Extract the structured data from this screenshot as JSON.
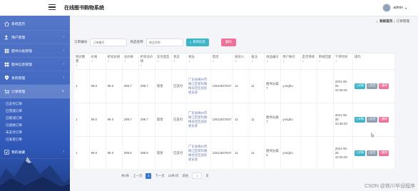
{
  "app": {
    "title": "在线图书购物系统",
    "user_name": "admin",
    "caret": "▾"
  },
  "sidebar": {
    "items": [
      {
        "label": "系统首页",
        "icon": "home-icon",
        "arrow": ""
      },
      {
        "label": "用户管理",
        "icon": "users-icon",
        "arrow": "‹"
      },
      {
        "label": "图书分类管理",
        "icon": "grid-icon",
        "arrow": "‹"
      },
      {
        "label": "图书信息管理",
        "icon": "grid-icon",
        "arrow": "‹"
      },
      {
        "label": "系统管理",
        "icon": "pin-icon",
        "arrow": "‹"
      },
      {
        "label": "订单管理",
        "icon": "cart-icon",
        "arrow": "∨"
      }
    ],
    "submenu": [
      "已支付订单",
      "已完成订单",
      "已取消订单",
      "已退款订单",
      "未支付订单",
      "已发货订单"
    ],
    "last_item": {
      "label": "我的收藏",
      "icon": "star-icon",
      "arrow": "‹"
    }
  },
  "breadcrumb": {
    "home": "系统首页",
    "separator": "/",
    "current": "订单管理"
  },
  "filter": {
    "order_no_label": "订单编号",
    "order_no_placeholder": "订单编号",
    "book_name_label": "商品名称",
    "book_name_placeholder": "商品名称",
    "search_label": "查询信息",
    "delete_label": "删除"
  },
  "table": {
    "columns": [
      {
        "label": "购买数量",
        "sort": "⇕"
      },
      {
        "label": "价格",
        "sort": "⇕"
      },
      {
        "label": "折扣价格",
        "sort": "⇕"
      },
      {
        "label": "总价格",
        "sort": "⇕"
      },
      {
        "label": "折扣总价格",
        "sort": "⇕"
      },
      {
        "label": "支付类型",
        "sort": "⇕"
      },
      {
        "label": "状态",
        "sort": "⇕"
      },
      {
        "label": "地址",
        "sort": "⇕"
      },
      {
        "label": "电话",
        "sort": "⇕"
      },
      {
        "label": "收货人",
        "sort": "⇕"
      },
      {
        "label": "备注",
        "sort": "⇕"
      },
      {
        "label": "商品编号",
        "sort": "⇕"
      },
      {
        "label": "用户账号",
        "sort": "⇕"
      },
      {
        "label": "是否审核",
        "sort": "⇕"
      },
      {
        "label": "审核回复",
        "sort": "⇕"
      },
      {
        "label": "下单时间",
        "sort": "⇕"
      },
      {
        "label": "操作",
        "sort": ""
      }
    ],
    "rows": [
      {
        "qty": "1",
        "price": "99.0",
        "discount_price": "99.0",
        "total": "299.7",
        "discount_total": "299.7",
        "pay": "现金",
        "status": "已支付",
        "address": "广东省梅州市梅江区新科路-梅龙社区居民委员会",
        "phone": "13612547847",
        "receiver": "11",
        "remark": "11",
        "product": "图书分类7",
        "user": "yonghu",
        "audited": "",
        "reply": "",
        "time": "2021-05-25 10:36:03"
      },
      {
        "qty": "1",
        "price": "99.0",
        "discount_price": "99.0",
        "total": "299.7",
        "discount_total": "299.7",
        "pay": "现金",
        "status": "已支付",
        "address": "广东省梅州市梅江区新科路-梅龙社区居民委员会",
        "phone": "13612547847",
        "receiver": "11",
        "remark": "11",
        "product": "图书分类7",
        "user": "yonghu",
        "audited": "",
        "reply": "",
        "time": "2021-05-25 10:36:03"
      },
      {
        "qty": "1",
        "price": "99.0",
        "discount_price": "99.0",
        "total": "299.6",
        "discount_total": "299.6",
        "pay": "现金",
        "status": "已支付",
        "address": "广东省梅州市梅江区新科路-梅龙社区居民委员会",
        "phone": "13612547847",
        "receiver": "11",
        "remark": "11",
        "product": "图书分类5",
        "user": "yonghu",
        "audited": "",
        "reply": "",
        "time": "2021-05-25 10:36:03"
      }
    ],
    "ops": {
      "detail": "◻详情",
      "ship": "◻发货",
      "delete": "◻删除"
    }
  },
  "pager": {
    "total": "共3条",
    "prev": "上一页",
    "current": "1",
    "next": "下一页",
    "per_page": "10条/页",
    "goto_label": "前往",
    "goto_value": "1",
    "goto_suffix": "页"
  },
  "watermark": "CSDN @铁川毕设程序"
}
